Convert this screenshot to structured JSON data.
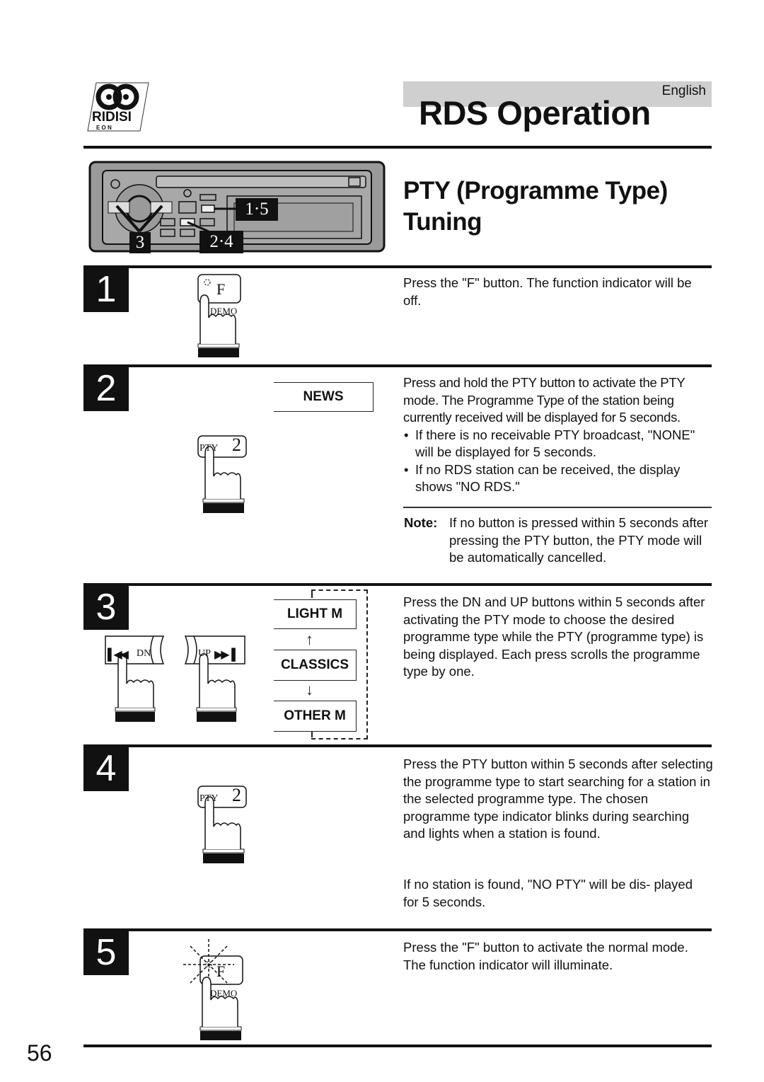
{
  "header": {
    "language": "English",
    "title": "RDS Operation",
    "logo": {
      "name": "RDS EON logo",
      "letters": "RDS",
      "sub_letters": "EON"
    }
  },
  "section": {
    "title_line1": "PTY (Programme Type)",
    "title_line2": "Tuning"
  },
  "radio_diagram": {
    "callouts": [
      "1·5",
      "3",
      "2·4"
    ]
  },
  "steps": [
    {
      "number": "1",
      "button": {
        "label": "F",
        "sub_label": "DEMO"
      },
      "text": "Press the \"F\" button. The function indicator will be off."
    },
    {
      "number": "2",
      "button": {
        "label": "PTY",
        "number": "2"
      },
      "display": "NEWS",
      "text": "Press and hold the PTY button to activate the PTY mode. The Programme Type of the station being currently received will be displayed for 5 seconds.",
      "bullets": [
        "If there is no receivable PTY broadcast, \"NONE\" will be displayed for 5 seconds.",
        "If no RDS station can be received, the display shows \"NO RDS.\""
      ],
      "note": {
        "label": "Note:",
        "text": "If no button is pressed within 5 seconds after pressing the PTY button, the PTY mode will be automatically cancelled."
      }
    },
    {
      "number": "3",
      "buttons": [
        {
          "label": "DN",
          "icon": "skip-back-icon"
        },
        {
          "label": "UP",
          "icon": "skip-forward-icon"
        }
      ],
      "display_cycle": [
        "LIGHT M",
        "CLASSICS",
        "OTHER M"
      ],
      "arrows": [
        "↑",
        "↓"
      ],
      "text": "Press the DN and UP buttons within 5 seconds after activating the PTY mode to choose the desired programme type while the PTY (programme type) is being displayed. Each press scrolls the programme type by one."
    },
    {
      "number": "4",
      "button": {
        "label": "PTY",
        "number": "2"
      },
      "text": "Press the PTY button within 5 seconds after selecting the programme type to start searching for a station in the selected programme type. The chosen programme type indicator blinks during searching and lights when a station is found.",
      "text2": "If no station is found, \"NO PTY\" will be dis- played for 5 seconds."
    },
    {
      "number": "5",
      "button": {
        "label": "F",
        "sub_label": "DEMO"
      },
      "text": "Press the \"F\" button to activate the normal mode.  The function indicator will illuminate."
    }
  ],
  "footer": {
    "page_number": "56"
  }
}
